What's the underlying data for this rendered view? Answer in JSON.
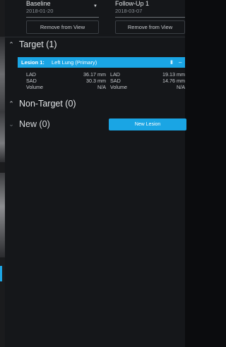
{
  "timepoints": [
    {
      "name": "Baseline",
      "date": "2018-01-20",
      "remove_label": "Remove from View"
    },
    {
      "name": "Follow-Up 1",
      "date": "2018-03-07",
      "remove_label": "Remove from View"
    }
  ],
  "target_section": {
    "title": "Target (1)"
  },
  "lesion": {
    "label": "Lesion 1:",
    "location": "Left Lung (Primary)",
    "rows": [
      {
        "label": "LAD",
        "v1": "36.17 mm",
        "label2": "LAD",
        "v2": "19.13 mm"
      },
      {
        "label": "SAD",
        "v1": "30.3 mm",
        "label2": "SAD",
        "v2": "14.76 mm"
      },
      {
        "label": "Volume",
        "v1": "N/A",
        "label2": "Volume",
        "v2": "N/A"
      }
    ]
  },
  "nontarget_section": {
    "title": "Non-Target (0)"
  },
  "new_section": {
    "title": "New (0)",
    "button_label": "New Lesion"
  },
  "colors": {
    "accent": "#1aa5e4",
    "panel": "#15171a",
    "background": "#0b0c0e"
  }
}
